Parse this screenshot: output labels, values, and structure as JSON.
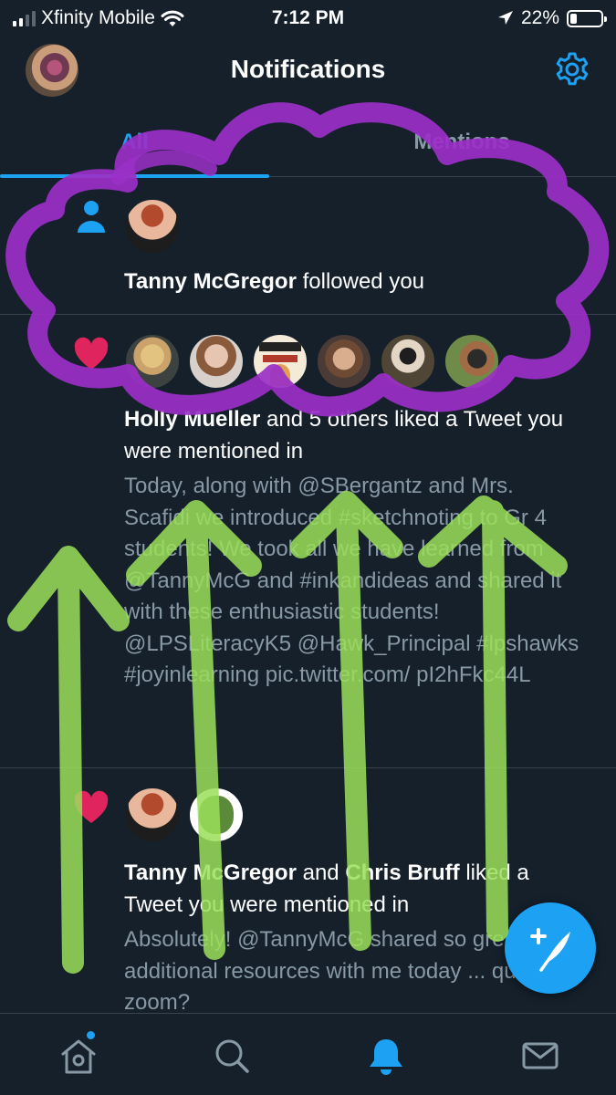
{
  "status_bar": {
    "carrier": "Xfinity Mobile",
    "time": "7:12 PM",
    "battery": "22%",
    "battery_level": 0.22
  },
  "header": {
    "title": "Notifications"
  },
  "tabs": [
    {
      "label": "All",
      "active": true
    },
    {
      "label": "Mentions",
      "active": false
    }
  ],
  "notifications": [
    {
      "type": "follow",
      "icon": "person-icon",
      "actor": "Tanny McGregor",
      "action": " followed you"
    },
    {
      "type": "like",
      "icon": "heart-icon",
      "actor": "Holly Mueller",
      "action": " and 5 others liked a Tweet you were mentioned in",
      "body": "Today, along with @SBergantz and Mrs. Scafidi we introduced #sketchnoting to Gr 4 students! We took all we have learned from @TannyMcG and #inkandideas and shared it with these enthusiastic students! @LPSLiteracyK5 @Hawk_Principal #lpshawks #joyinlearning pic.twitter.com/ pI2hFkc44L",
      "avatar_badge_text": "Knowledge is POWER"
    },
    {
      "type": "like",
      "icon": "heart-icon",
      "actor": "Tanny McGregor",
      "joiner": " and ",
      "actor2": "Chris Bruff",
      "action": " liked a Tweet you were mentioned in",
      "body": "Absolutely! @TannyMcG shared so great additional resources with me today ... quick zoom?"
    }
  ],
  "fab": {
    "icon": "compose-tweet-icon"
  },
  "bottom_nav": [
    {
      "icon": "home-icon",
      "active": false,
      "has_dot": true
    },
    {
      "icon": "search-icon",
      "active": false
    },
    {
      "icon": "notifications-bell-icon",
      "active": true
    },
    {
      "icon": "messages-envelope-icon",
      "active": false
    }
  ],
  "colors": {
    "background": "#15202b",
    "accent": "#1da1f2",
    "muted_text": "#8899a6",
    "heart": "#e0245e",
    "annotation_purple": "#9b30c8",
    "annotation_green": "#9be05a"
  }
}
